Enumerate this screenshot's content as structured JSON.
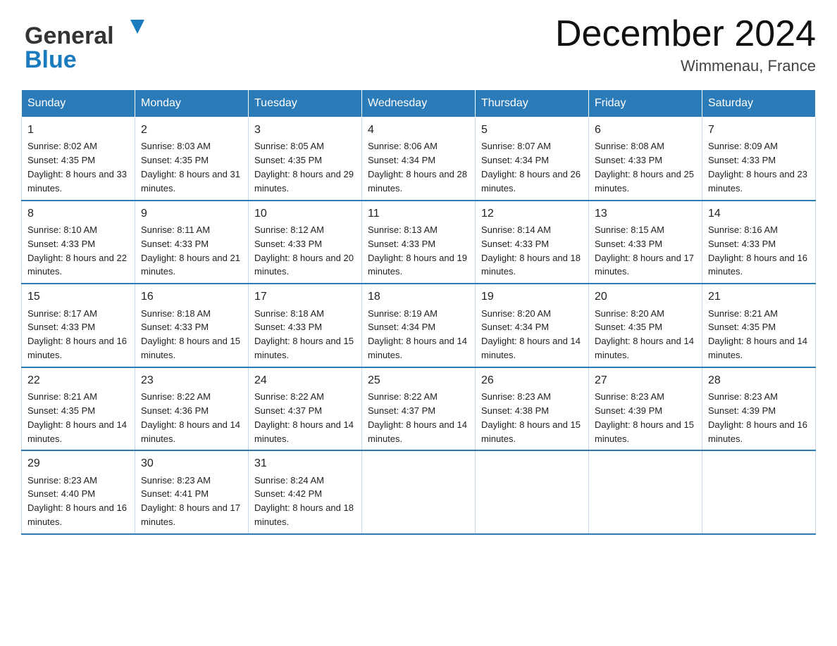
{
  "header": {
    "title": "December 2024",
    "subtitle": "Wimmenau, France",
    "logo_general": "General",
    "logo_blue": "Blue"
  },
  "days_of_week": [
    "Sunday",
    "Monday",
    "Tuesday",
    "Wednesday",
    "Thursday",
    "Friday",
    "Saturday"
  ],
  "weeks": [
    [
      {
        "day": "1",
        "sunrise": "8:02 AM",
        "sunset": "4:35 PM",
        "daylight": "8 hours and 33 minutes."
      },
      {
        "day": "2",
        "sunrise": "8:03 AM",
        "sunset": "4:35 PM",
        "daylight": "8 hours and 31 minutes."
      },
      {
        "day": "3",
        "sunrise": "8:05 AM",
        "sunset": "4:35 PM",
        "daylight": "8 hours and 29 minutes."
      },
      {
        "day": "4",
        "sunrise": "8:06 AM",
        "sunset": "4:34 PM",
        "daylight": "8 hours and 28 minutes."
      },
      {
        "day": "5",
        "sunrise": "8:07 AM",
        "sunset": "4:34 PM",
        "daylight": "8 hours and 26 minutes."
      },
      {
        "day": "6",
        "sunrise": "8:08 AM",
        "sunset": "4:33 PM",
        "daylight": "8 hours and 25 minutes."
      },
      {
        "day": "7",
        "sunrise": "8:09 AM",
        "sunset": "4:33 PM",
        "daylight": "8 hours and 23 minutes."
      }
    ],
    [
      {
        "day": "8",
        "sunrise": "8:10 AM",
        "sunset": "4:33 PM",
        "daylight": "8 hours and 22 minutes."
      },
      {
        "day": "9",
        "sunrise": "8:11 AM",
        "sunset": "4:33 PM",
        "daylight": "8 hours and 21 minutes."
      },
      {
        "day": "10",
        "sunrise": "8:12 AM",
        "sunset": "4:33 PM",
        "daylight": "8 hours and 20 minutes."
      },
      {
        "day": "11",
        "sunrise": "8:13 AM",
        "sunset": "4:33 PM",
        "daylight": "8 hours and 19 minutes."
      },
      {
        "day": "12",
        "sunrise": "8:14 AM",
        "sunset": "4:33 PM",
        "daylight": "8 hours and 18 minutes."
      },
      {
        "day": "13",
        "sunrise": "8:15 AM",
        "sunset": "4:33 PM",
        "daylight": "8 hours and 17 minutes."
      },
      {
        "day": "14",
        "sunrise": "8:16 AM",
        "sunset": "4:33 PM",
        "daylight": "8 hours and 16 minutes."
      }
    ],
    [
      {
        "day": "15",
        "sunrise": "8:17 AM",
        "sunset": "4:33 PM",
        "daylight": "8 hours and 16 minutes."
      },
      {
        "day": "16",
        "sunrise": "8:18 AM",
        "sunset": "4:33 PM",
        "daylight": "8 hours and 15 minutes."
      },
      {
        "day": "17",
        "sunrise": "8:18 AM",
        "sunset": "4:33 PM",
        "daylight": "8 hours and 15 minutes."
      },
      {
        "day": "18",
        "sunrise": "8:19 AM",
        "sunset": "4:34 PM",
        "daylight": "8 hours and 14 minutes."
      },
      {
        "day": "19",
        "sunrise": "8:20 AM",
        "sunset": "4:34 PM",
        "daylight": "8 hours and 14 minutes."
      },
      {
        "day": "20",
        "sunrise": "8:20 AM",
        "sunset": "4:35 PM",
        "daylight": "8 hours and 14 minutes."
      },
      {
        "day": "21",
        "sunrise": "8:21 AM",
        "sunset": "4:35 PM",
        "daylight": "8 hours and 14 minutes."
      }
    ],
    [
      {
        "day": "22",
        "sunrise": "8:21 AM",
        "sunset": "4:35 PM",
        "daylight": "8 hours and 14 minutes."
      },
      {
        "day": "23",
        "sunrise": "8:22 AM",
        "sunset": "4:36 PM",
        "daylight": "8 hours and 14 minutes."
      },
      {
        "day": "24",
        "sunrise": "8:22 AM",
        "sunset": "4:37 PM",
        "daylight": "8 hours and 14 minutes."
      },
      {
        "day": "25",
        "sunrise": "8:22 AM",
        "sunset": "4:37 PM",
        "daylight": "8 hours and 14 minutes."
      },
      {
        "day": "26",
        "sunrise": "8:23 AM",
        "sunset": "4:38 PM",
        "daylight": "8 hours and 15 minutes."
      },
      {
        "day": "27",
        "sunrise": "8:23 AM",
        "sunset": "4:39 PM",
        "daylight": "8 hours and 15 minutes."
      },
      {
        "day": "28",
        "sunrise": "8:23 AM",
        "sunset": "4:39 PM",
        "daylight": "8 hours and 16 minutes."
      }
    ],
    [
      {
        "day": "29",
        "sunrise": "8:23 AM",
        "sunset": "4:40 PM",
        "daylight": "8 hours and 16 minutes."
      },
      {
        "day": "30",
        "sunrise": "8:23 AM",
        "sunset": "4:41 PM",
        "daylight": "8 hours and 17 minutes."
      },
      {
        "day": "31",
        "sunrise": "8:24 AM",
        "sunset": "4:42 PM",
        "daylight": "8 hours and 18 minutes."
      },
      null,
      null,
      null,
      null
    ]
  ],
  "labels": {
    "sunrise": "Sunrise:",
    "sunset": "Sunset:",
    "daylight": "Daylight:"
  }
}
